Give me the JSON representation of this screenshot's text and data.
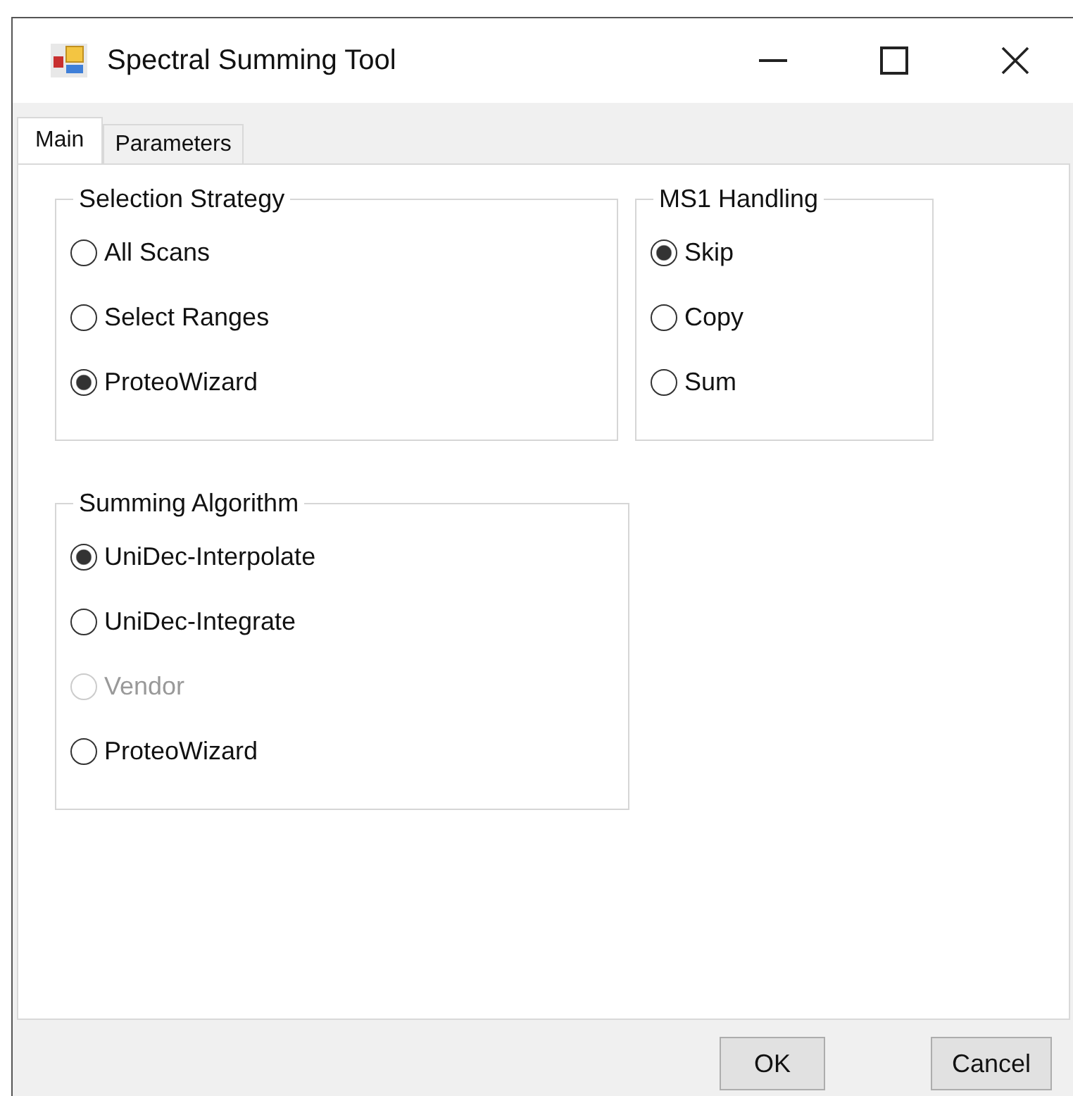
{
  "window": {
    "title": "Spectral Summing Tool"
  },
  "tabs": [
    {
      "label": "Main",
      "selected": true
    },
    {
      "label": "Parameters",
      "selected": false
    }
  ],
  "groups": [
    {
      "title": "Selection Strategy",
      "options": [
        {
          "label": "All Scans",
          "selected": false,
          "disabled": false
        },
        {
          "label": "Select Ranges",
          "selected": false,
          "disabled": false
        },
        {
          "label": "ProteoWizard",
          "selected": true,
          "disabled": false
        }
      ]
    },
    {
      "title": "MS1 Handling",
      "options": [
        {
          "label": "Skip",
          "selected": true,
          "disabled": false
        },
        {
          "label": "Copy",
          "selected": false,
          "disabled": false
        },
        {
          "label": "Sum",
          "selected": false,
          "disabled": false
        }
      ]
    },
    {
      "title": "Summing Algorithm",
      "options": [
        {
          "label": "UniDec-Interpolate",
          "selected": true,
          "disabled": false
        },
        {
          "label": "UniDec-Integrate",
          "selected": false,
          "disabled": false
        },
        {
          "label": "Vendor",
          "selected": false,
          "disabled": true
        },
        {
          "label": "ProteoWizard",
          "selected": false,
          "disabled": false
        }
      ]
    }
  ],
  "buttons": [
    "OK",
    "Cancel"
  ]
}
